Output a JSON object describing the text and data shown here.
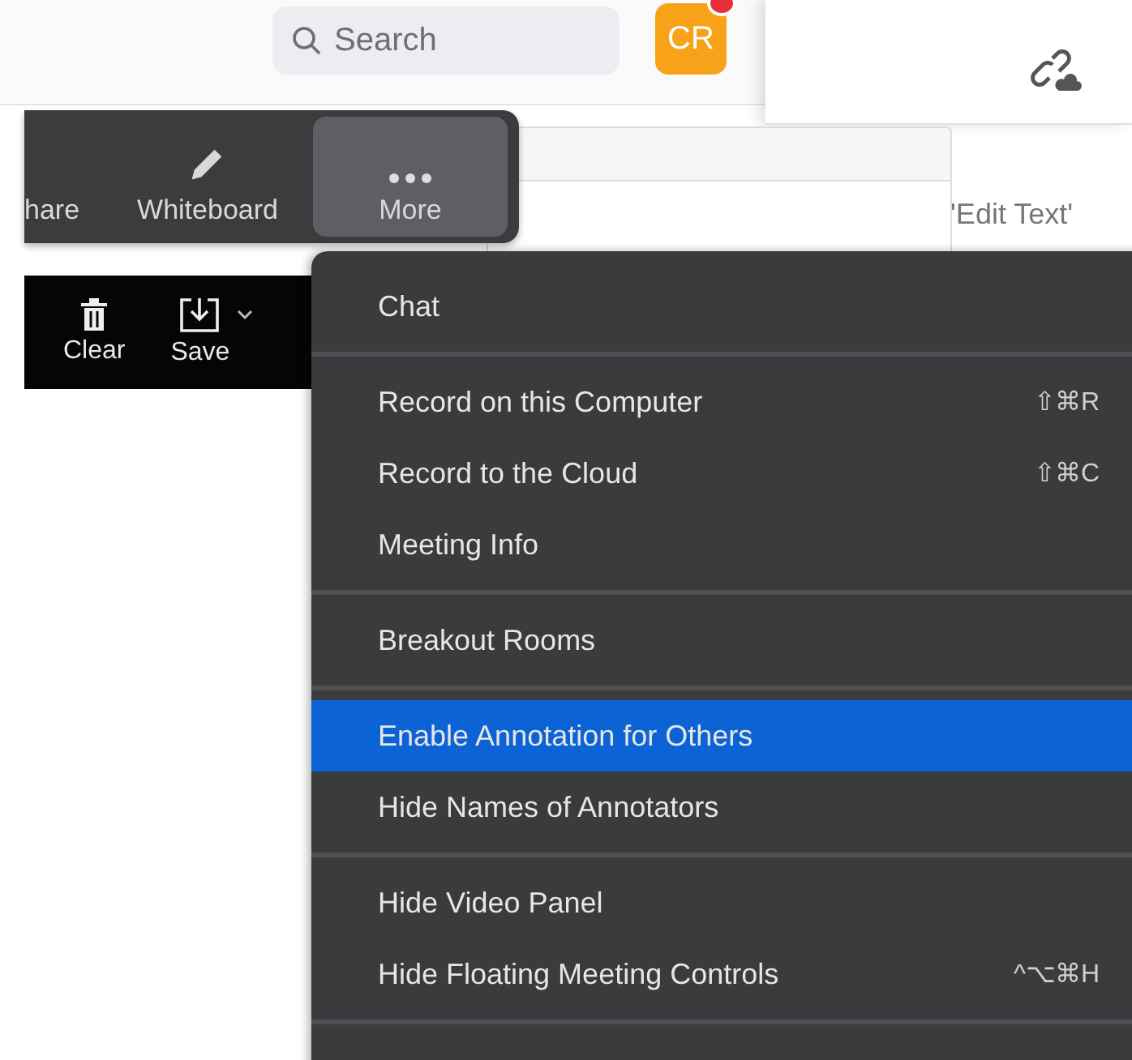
{
  "search": {
    "placeholder": "Search"
  },
  "avatar": {
    "initials": "CR",
    "notification": true
  },
  "background_text": "'Edit Text'",
  "meeting_toolbar": [
    {
      "label": "hare",
      "kind": "plain",
      "selected": false
    },
    {
      "label": "Whiteboard",
      "kind": "pencil",
      "selected": false
    },
    {
      "label": "More",
      "kind": "dots",
      "selected": true
    }
  ],
  "annotation_toolbar": [
    {
      "label": "Clear",
      "kind": "trash",
      "dropdown": false
    },
    {
      "label": "Save",
      "kind": "save",
      "dropdown": true
    }
  ],
  "menu": [
    [
      {
        "label": "Chat",
        "selected": false
      }
    ],
    [
      {
        "label": "Record on this Computer",
        "shortcut": "⇧⌘R",
        "selected": false
      },
      {
        "label": "Record to the Cloud",
        "shortcut": "⇧⌘C",
        "selected": false
      },
      {
        "label": "Meeting Info",
        "selected": false
      }
    ],
    [
      {
        "label": "Breakout Rooms",
        "selected": false
      }
    ],
    [
      {
        "label": "Enable Annotation for Others",
        "selected": true
      },
      {
        "label": "Hide Names of Annotators",
        "selected": false
      }
    ],
    [
      {
        "label": "Hide Video Panel",
        "selected": false
      },
      {
        "label": "Hide Floating Meeting Controls",
        "shortcut": "^⌥⌘H",
        "selected": false
      }
    ]
  ]
}
